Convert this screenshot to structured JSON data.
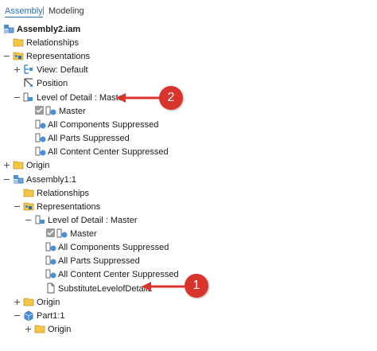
{
  "tabs": [
    {
      "label": "Assembly"
    },
    {
      "label": "Modeling"
    }
  ],
  "tab_separator": "|",
  "tree": {
    "root": "Assembly2.iam",
    "relationships": "Relationships",
    "representations": "Representations",
    "view": "View: Default",
    "position": "Position",
    "lod": "Level of Detail : Master",
    "master": "Master",
    "all_components": "All Components Suppressed",
    "all_parts": "All Parts Suppressed",
    "all_content": "All Content Center Suppressed",
    "origin": "Origin",
    "sub_assembly": "Assembly1:1",
    "sub_relationships": "Relationships",
    "sub_representations": "Representations",
    "sub_lod": "Level of Detail : Master",
    "sub_master": "Master",
    "sub_all_components": "All Components Suppressed",
    "sub_all_parts": "All Parts Suppressed",
    "sub_all_content": "All Content Center Suppressed",
    "substitute": "SubstituteLevelofDetail1",
    "sub_origin": "Origin",
    "part": "Part1:1",
    "part_origin": "Origin"
  },
  "callouts": [
    {
      "number": "2"
    },
    {
      "number": "1"
    }
  ],
  "colors": {
    "callout": "#d9342b",
    "folder": "#f3c545",
    "part_blue": "#4a90d9",
    "active_tab": "#2a6fb5"
  }
}
